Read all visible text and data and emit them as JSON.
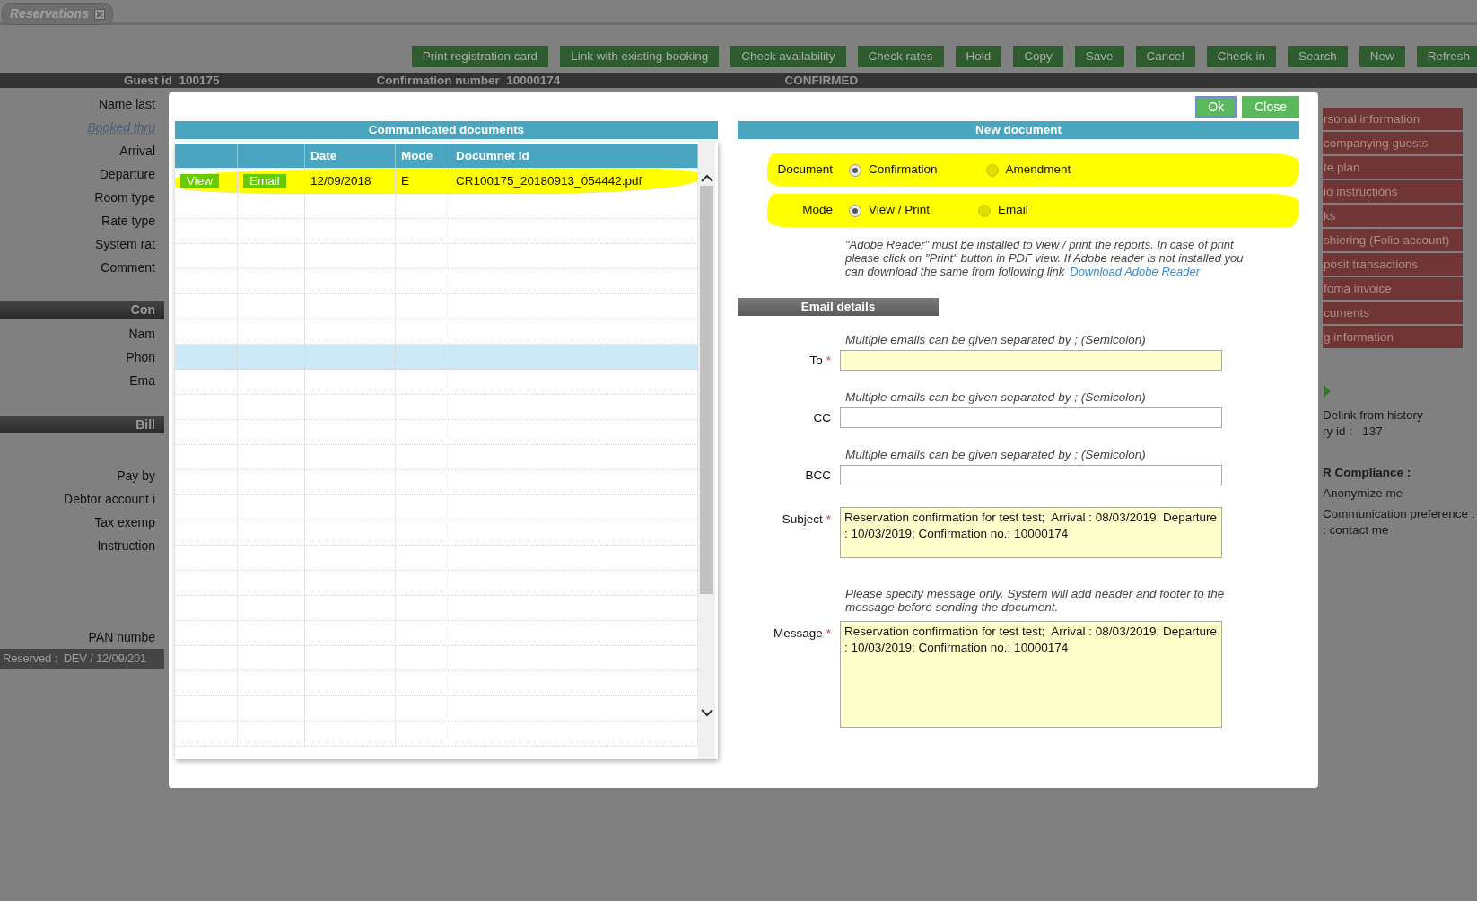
{
  "app_tab": {
    "label": "Reservations"
  },
  "toolbar": [
    "Print registration card",
    "Link with existing booking",
    "Check availability",
    "Check rates",
    "Hold",
    "Copy",
    "Save",
    "Cancel",
    "Check-in",
    "Search",
    "New",
    "Refresh"
  ],
  "header": {
    "guest_id_label": "Guest id",
    "guest_id": "100175",
    "confirmation_label": "Confirmation number",
    "confirmation": "10000174",
    "status": "CONFIRMED"
  },
  "form_labels": [
    {
      "text": "Name last",
      "kind": "label"
    },
    {
      "text": "Booked thru",
      "kind": "link"
    },
    {
      "text": "Arrival",
      "kind": "label"
    },
    {
      "text": "Departure",
      "kind": "label"
    },
    {
      "text": "Room type",
      "kind": "label"
    },
    {
      "text": "Rate type",
      "kind": "label"
    },
    {
      "text": "System rat",
      "kind": "label"
    },
    {
      "text": "Comment",
      "kind": "label"
    },
    {
      "text": "Con",
      "kind": "section"
    },
    {
      "text": "Nam",
      "kind": "label"
    },
    {
      "text": "Phon",
      "kind": "label"
    },
    {
      "text": "Ema",
      "kind": "label"
    },
    {
      "text": "Bill",
      "kind": "section"
    },
    {
      "text": "Pay by",
      "kind": "label"
    },
    {
      "text": "Debtor account i",
      "kind": "label"
    },
    {
      "text": "Tax exemp",
      "kind": "label"
    },
    {
      "text": "Instruction",
      "kind": "label"
    },
    {
      "text": "PAN numbe",
      "kind": "label"
    }
  ],
  "footer": {
    "label": "Reserved :",
    "value": "DEV / 12/09/201"
  },
  "side_menu": [
    "rsonal information",
    "companying guests",
    "te plan",
    "io instructions",
    "ks",
    "shiering (Folio account)",
    "posit transactions",
    "foma invoice",
    "cuments",
    "g information"
  ],
  "history": {
    "delink": "Delink from history",
    "id_label": "ry id :",
    "id": "137"
  },
  "compliance": {
    "title": "R Compliance :",
    "items": [
      "Anonymize me",
      "Communication preference :",
      ": contact me"
    ]
  },
  "modal": {
    "buttons": [
      {
        "label": "Ok",
        "focused": true
      },
      {
        "label": "Close",
        "focused": false
      }
    ],
    "documents": {
      "title": "Communicated documents",
      "columns": [
        "Date",
        "Mode",
        "Documnet id"
      ],
      "rows": [
        {
          "view": "View",
          "email": "Email",
          "date": "12/09/2018",
          "mode": "E",
          "document_id": "CR100175_20180913_054442.pdf",
          "highlighted": true,
          "selected": false
        },
        {
          "selected": false
        },
        {
          "selected": false
        },
        {
          "selected": false
        },
        {
          "selected": false
        },
        {
          "selected": false
        },
        {
          "selected": false
        },
        {
          "selected": true
        },
        {
          "selected": false
        },
        {
          "selected": false
        },
        {
          "selected": false
        },
        {
          "selected": false
        },
        {
          "selected": false
        },
        {
          "selected": false
        },
        {
          "selected": false
        },
        {
          "selected": false
        },
        {
          "selected": false
        },
        {
          "selected": false
        },
        {
          "selected": false
        },
        {
          "selected": false
        },
        {
          "selected": false
        },
        {
          "selected": false
        },
        {
          "selected": false
        }
      ]
    },
    "new_document": {
      "title": "New document",
      "groups": [
        {
          "label": "Document",
          "highlighted": true,
          "options": [
            {
              "label": "Confirmation",
              "selected": true
            },
            {
              "label": "Amendment",
              "selected": false
            }
          ]
        },
        {
          "label": "Mode",
          "highlighted": true,
          "options": [
            {
              "label": "View / Print",
              "selected": true
            },
            {
              "label": "Email",
              "selected": false
            }
          ]
        }
      ],
      "note": "\"Adobe Reader\" must be installed to view / print the reports. In case of print please click on \"Print\" button in PDF view. If Adobe reader is not installed you can download the same from following link",
      "note_link": "Download Adobe Reader"
    },
    "email_details": {
      "title": "Email details",
      "fields": [
        {
          "kind": "input",
          "label": "To",
          "required_mark": "*",
          "hint": "Multiple emails can be given separated by ; (Semicolon)"
        },
        {
          "kind": "input",
          "label": "CC",
          "hint": "Multiple emails can be given separated by ; (Semicolon)"
        },
        {
          "kind": "input",
          "label": "BCC",
          "hint": "Multiple emails can be given separated by ; (Semicolon)"
        },
        {
          "kind": "textarea",
          "label": "Subject",
          "required_mark": "*",
          "value": "Reservation confirmation for test test;  Arrival : 08/03/2019; Departure : 10/03/2019; Confirmation no.: 10000174"
        },
        {
          "kind": "textarea",
          "label": "Message",
          "required_mark": "*",
          "hint": "Please specify message only. System will add header and footer to the message before sending the document.",
          "value": "Reservation confirmation for test test;  Arrival : 08/03/2019; Departure : 10/03/2019; Confirmation no.: 10000174"
        }
      ]
    }
  }
}
